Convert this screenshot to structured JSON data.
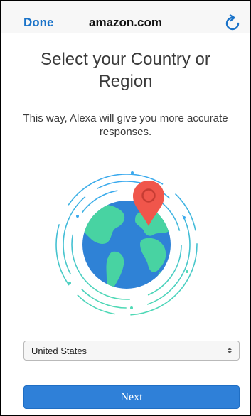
{
  "browser": {
    "done_label": "Done",
    "domain": "amazon.com",
    "reload_icon": "reload-icon"
  },
  "page": {
    "title": "Select your Country or Region",
    "subtitle": "This way, Alexa will give you more accurate responses."
  },
  "illustration": {
    "icon": "globe-location-pin-icon",
    "colors": {
      "ocean": "#2f82d6",
      "land": "#48d3a2",
      "pin": "#f0564b",
      "ring": "#3db7e8"
    }
  },
  "country_select": {
    "selected": "United States"
  },
  "next_label": "Next",
  "colors": {
    "accent": "#1a73c9",
    "button": "#2f80d8"
  }
}
